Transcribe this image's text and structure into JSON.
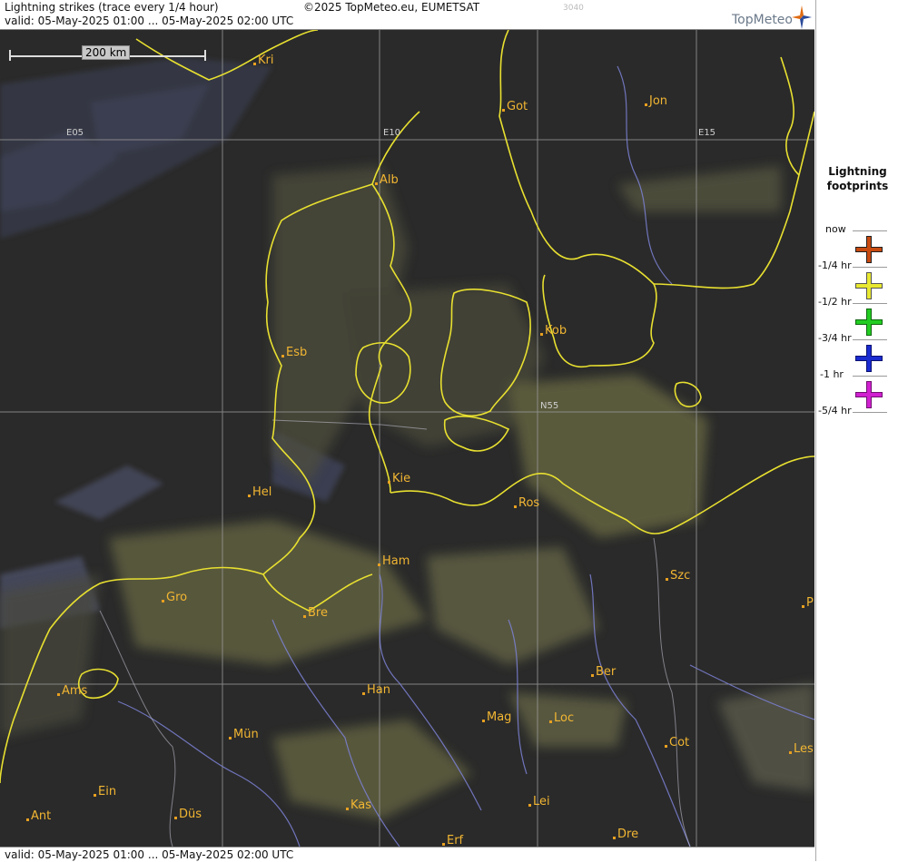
{
  "header": {
    "title": "Lightning strikes (trace every 1/4 hour)",
    "credit": "©2025 TopMeteo.eu, EUMETSAT",
    "valid": "valid:  05-May-2025 01:00 ... 05-May-2025 02:00 UTC",
    "code": "3040"
  },
  "logo": {
    "text": "TopMeteo"
  },
  "footer": {
    "valid": "valid:  05-May-2025 01:00 ... 05-May-2025 02:00 UTC"
  },
  "scale": {
    "label": "200 km"
  },
  "grid": {
    "e05": "E05",
    "e10": "E10",
    "e15": "E15",
    "n55": "N55"
  },
  "cities": [
    {
      "id": "kri",
      "name": "Kri"
    },
    {
      "id": "got1",
      "name": "Got"
    },
    {
      "id": "jon",
      "name": "Jon"
    },
    {
      "id": "alb",
      "name": "Alb"
    },
    {
      "id": "esb",
      "name": "Esb"
    },
    {
      "id": "kob",
      "name": "Kob"
    },
    {
      "id": "kie",
      "name": "Kie"
    },
    {
      "id": "hel",
      "name": "Hel"
    },
    {
      "id": "ros",
      "name": "Ros"
    },
    {
      "id": "ham",
      "name": "Ham"
    },
    {
      "id": "szc",
      "name": "Szc"
    },
    {
      "id": "gro",
      "name": "Gro"
    },
    {
      "id": "bre",
      "name": "Bre"
    },
    {
      "id": "p",
      "name": "P"
    },
    {
      "id": "ber",
      "name": "Ber"
    },
    {
      "id": "ams",
      "name": "Ams"
    },
    {
      "id": "han",
      "name": "Han"
    },
    {
      "id": "mag",
      "name": "Mag"
    },
    {
      "id": "loc",
      "name": "Loc"
    },
    {
      "id": "mun",
      "name": "Mün"
    },
    {
      "id": "cot",
      "name": "Cot"
    },
    {
      "id": "les",
      "name": "Les"
    },
    {
      "id": "ein",
      "name": "Ein"
    },
    {
      "id": "kas",
      "name": "Kas"
    },
    {
      "id": "lei",
      "name": "Lei"
    },
    {
      "id": "ant",
      "name": "Ant"
    },
    {
      "id": "dus",
      "name": "Düs"
    },
    {
      "id": "dre",
      "name": "Dre"
    },
    {
      "id": "erf",
      "name": "Erf"
    }
  ],
  "legend": {
    "title_line1": "Lightning",
    "title_line2": "footprints",
    "ticks": [
      "now",
      "-1/4 hr",
      "-1/2 hr",
      "-3/4 hr",
      "-1 hr",
      "-5/4 hr"
    ],
    "colors": [
      "#c84a10",
      "#e8e830",
      "#22cc22",
      "#1a2bd0",
      "#d020d0"
    ]
  }
}
